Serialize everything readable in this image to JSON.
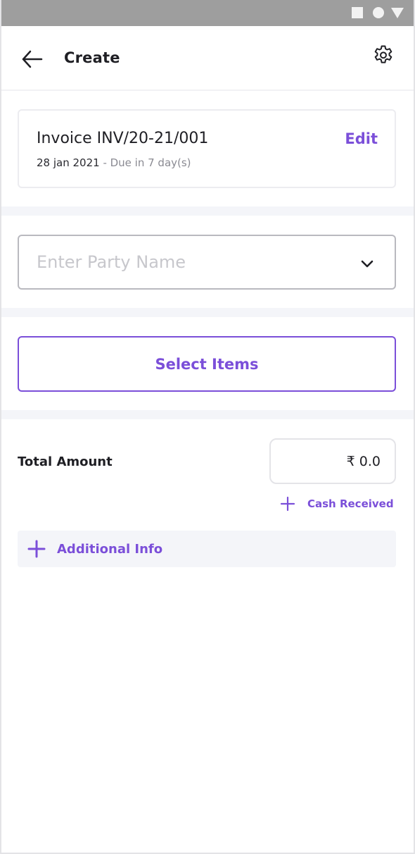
{
  "header": {
    "title": "Create",
    "back_icon": "arrow-left-icon",
    "settings_icon": "gear-icon"
  },
  "invoice": {
    "title": "Invoice INV/20-21/001",
    "date": "28 jan 2021",
    "due": " - Due in 7 day(s)",
    "edit_label": "Edit"
  },
  "party": {
    "placeholder": "Enter Party Name",
    "dropdown_icon": "chevron-down-icon"
  },
  "items": {
    "select_label": "Select Items"
  },
  "totals": {
    "label": "Total Amount",
    "amount": "₹ 0.0",
    "cash_received_label": "Cash Received"
  },
  "additional": {
    "label": "Additional Info"
  },
  "colors": {
    "accent": "#7b4fd9",
    "statusbar": "#9e9e9e",
    "section_divider": "#f4f5f9"
  }
}
